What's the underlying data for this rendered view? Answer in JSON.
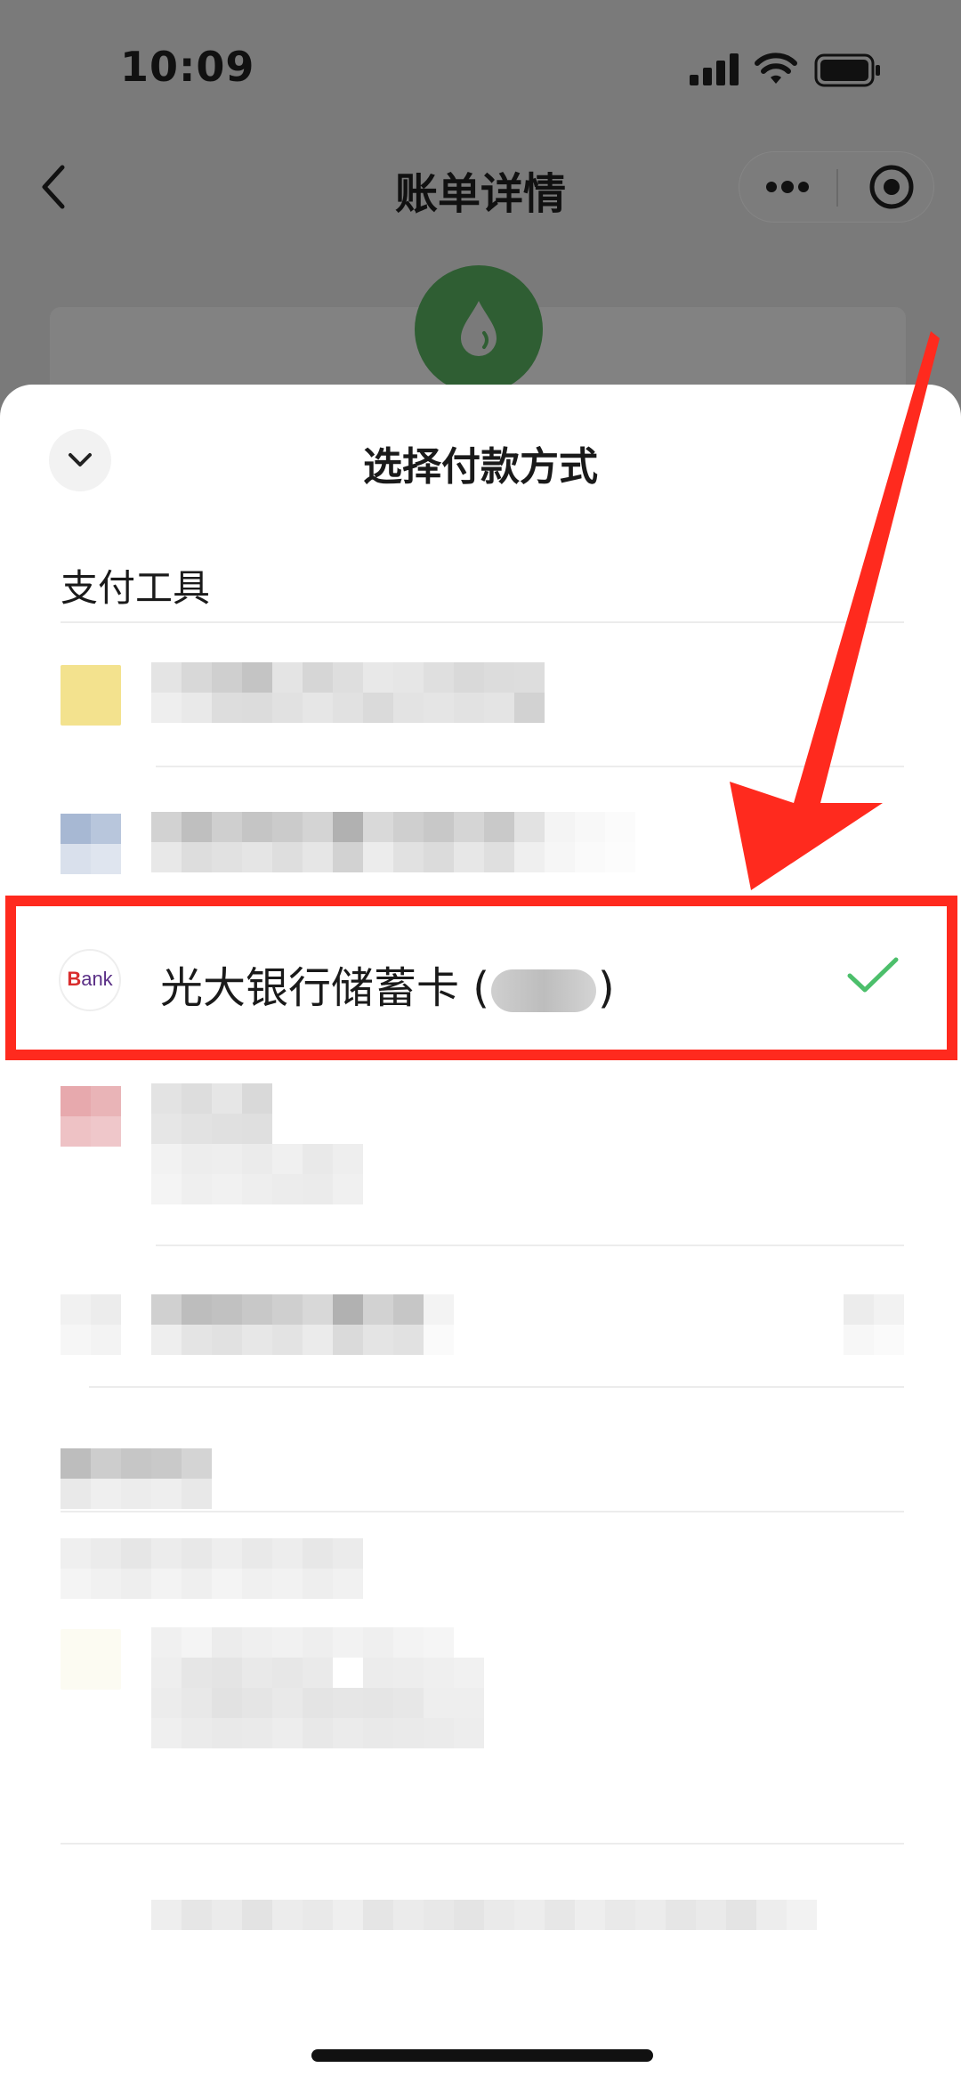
{
  "status_bar": {
    "time": "10:09"
  },
  "nav": {
    "title": "账单详情"
  },
  "sheet": {
    "title": "选择付款方式",
    "section_title": "支付工具",
    "selected_method": {
      "logo_text_b": "B",
      "logo_text_rest": "ank",
      "name_prefix": "光大银行储蓄卡 (",
      "name_suffix": ")",
      "selected": true
    }
  },
  "colors": {
    "highlight": "#ff2a1e",
    "check": "#4cbf6b",
    "bg_logo": "#2f5e33"
  },
  "icons": [
    "back-icon",
    "more-icon",
    "target-icon",
    "chevron-down-icon",
    "check-icon",
    "water-drop-icon"
  ]
}
